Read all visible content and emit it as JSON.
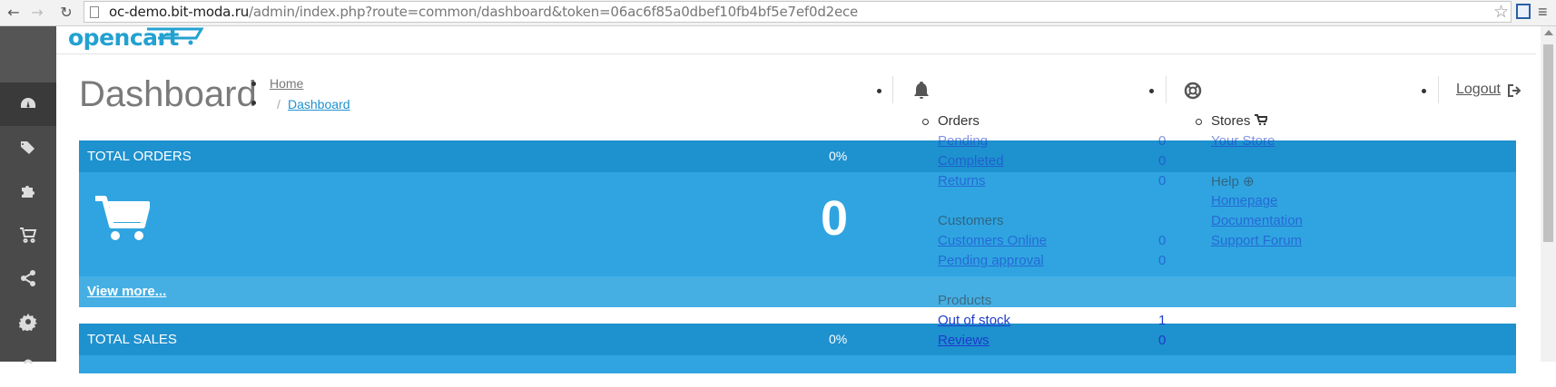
{
  "browser": {
    "url_host": "oc-demo.bit-moda.ru",
    "url_path": "/admin/index.php?route=common/dashboard&token=06ac6f85a0dbef10fb4bf5e7ef0d2ece"
  },
  "logo": {
    "text": "opencart"
  },
  "page": {
    "title": "Dashboard"
  },
  "breadcrumb": {
    "home": "Home",
    "separator": "/",
    "current": "Dashboard"
  },
  "header": {
    "logout": "Logout"
  },
  "tiles": {
    "orders": {
      "title": "TOTAL ORDERS",
      "percent": "0%",
      "value": "0",
      "link": "View more..."
    },
    "sales": {
      "title": "TOTAL SALES",
      "percent": "0%"
    }
  },
  "notifications": {
    "orders_label": "Orders",
    "pending": "Pending",
    "pending_count": "0",
    "completed": "Completed",
    "completed_count": "0",
    "returns": "Returns",
    "returns_count": "0",
    "customers_label": "Customers",
    "customers_online": "Customers Online",
    "customers_online_count": "0",
    "pending_approval": "Pending approval",
    "pending_approval_count": "0",
    "products_label": "Products",
    "out_of_stock": "Out of stock",
    "out_of_stock_count": "1",
    "reviews": "Reviews",
    "reviews_count": "0"
  },
  "stores": {
    "label": "Stores",
    "your_store": "Your Store",
    "help_label": "Help",
    "homepage": "Homepage",
    "documentation": "Documentation",
    "support_forum": "Support Forum"
  },
  "colors": {
    "accent": "#1e91cf",
    "tile_body": "#2fa4e1",
    "sidebar": "#4a4a4a",
    "logo": "#23a1d1"
  }
}
